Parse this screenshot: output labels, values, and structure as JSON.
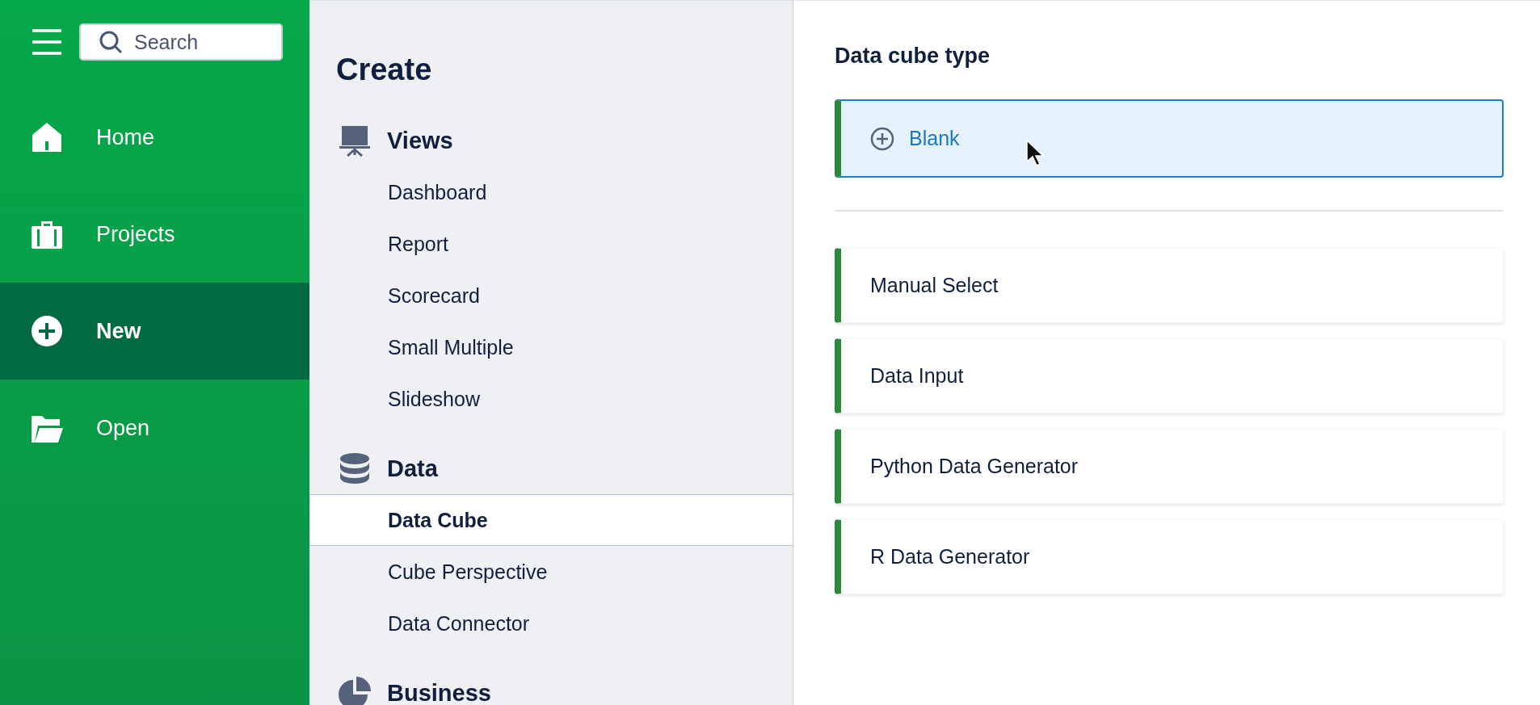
{
  "nav": {
    "search": {
      "placeholder": "Search"
    },
    "items": [
      {
        "kind": "home",
        "label": "Home",
        "selected": false
      },
      {
        "kind": "projects",
        "label": "Projects",
        "selected": false
      },
      {
        "kind": "new",
        "label": "New",
        "selected": true
      },
      {
        "kind": "open",
        "label": "Open",
        "selected": false
      }
    ]
  },
  "create": {
    "title": "Create",
    "sections": [
      {
        "kind": "views",
        "label": "Views",
        "items": [
          {
            "label": "Dashboard",
            "selected": false
          },
          {
            "label": "Report",
            "selected": false
          },
          {
            "label": "Scorecard",
            "selected": false
          },
          {
            "label": "Small Multiple",
            "selected": false
          },
          {
            "label": "Slideshow",
            "selected": false
          }
        ]
      },
      {
        "kind": "data",
        "label": "Data",
        "items": [
          {
            "label": "Data Cube",
            "selected": true
          },
          {
            "label": "Cube Perspective",
            "selected": false
          },
          {
            "label": "Data Connector",
            "selected": false
          }
        ]
      },
      {
        "kind": "business",
        "label": "Business"
      }
    ]
  },
  "detail": {
    "title": "Data cube type",
    "cards": [
      {
        "kind": "blank",
        "label": "Blank",
        "highlighted": true
      },
      {
        "kind": "option",
        "label": "Manual Select",
        "highlighted": false
      },
      {
        "kind": "option",
        "label": "Data Input",
        "highlighted": false
      },
      {
        "kind": "option",
        "label": "Python Data Generator",
        "highlighted": false
      },
      {
        "kind": "option",
        "label": "R Data Generator",
        "highlighted": false
      }
    ]
  }
}
